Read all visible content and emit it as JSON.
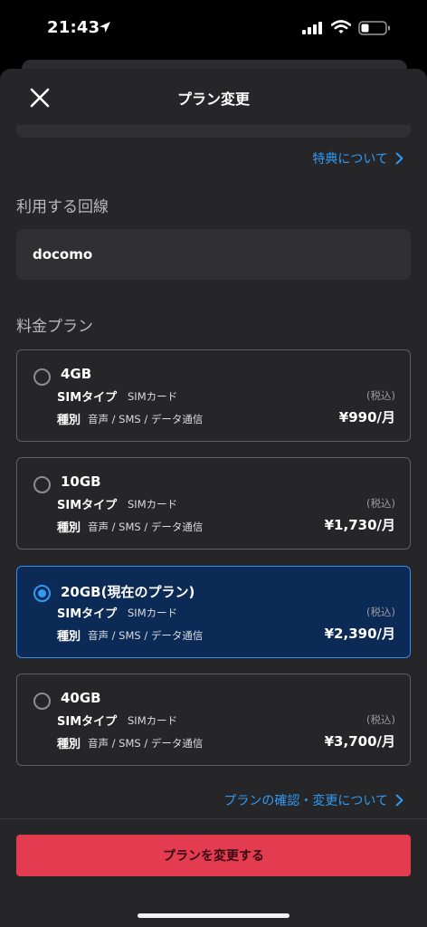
{
  "status_bar": {
    "time": "21:43"
  },
  "sheet": {
    "title": "プラン変更",
    "benefits_link": "特典について",
    "line_section_label": "利用する回線",
    "line_value": "docomo",
    "plan_section_label": "料金プラン",
    "plans": [
      {
        "name": "4GB",
        "selected": false,
        "sim_key": "SIMタイプ",
        "sim_value": "SIMカード",
        "kind_key": "種別",
        "kind_value": "音声 / SMS / データ通信",
        "tax": "(税込)",
        "price": "¥990/月"
      },
      {
        "name": "10GB",
        "selected": false,
        "sim_key": "SIMタイプ",
        "sim_value": "SIMカード",
        "kind_key": "種別",
        "kind_value": "音声 / SMS / データ通信",
        "tax": "(税込)",
        "price": "¥1,730/月"
      },
      {
        "name": "20GB(現在のプラン)",
        "selected": true,
        "sim_key": "SIMタイプ",
        "sim_value": "SIMカード",
        "kind_key": "種別",
        "kind_value": "音声 / SMS / データ通信",
        "tax": "(税込)",
        "price": "¥2,390/月"
      },
      {
        "name": "40GB",
        "selected": false,
        "sim_key": "SIMタイプ",
        "sim_value": "SIMカード",
        "kind_key": "種別",
        "kind_value": "音声 / SMS / データ通信",
        "tax": "(税込)",
        "price": "¥3,700/月"
      }
    ],
    "plan_info_link": "プランの確認・変更について",
    "cta_label": "プランを変更する"
  },
  "icons": {
    "close": "close-icon",
    "chevron": "chevron-right-icon",
    "location": "location-arrow-icon",
    "signal": "cellular-signal-icon",
    "wifi": "wifi-icon",
    "battery": "battery-icon"
  },
  "colors": {
    "accent_blue": "#2f9bf5",
    "selected_card_bg": "#0b2a55",
    "cta_red": "#e33b4f",
    "sheet_bg": "#262628"
  }
}
